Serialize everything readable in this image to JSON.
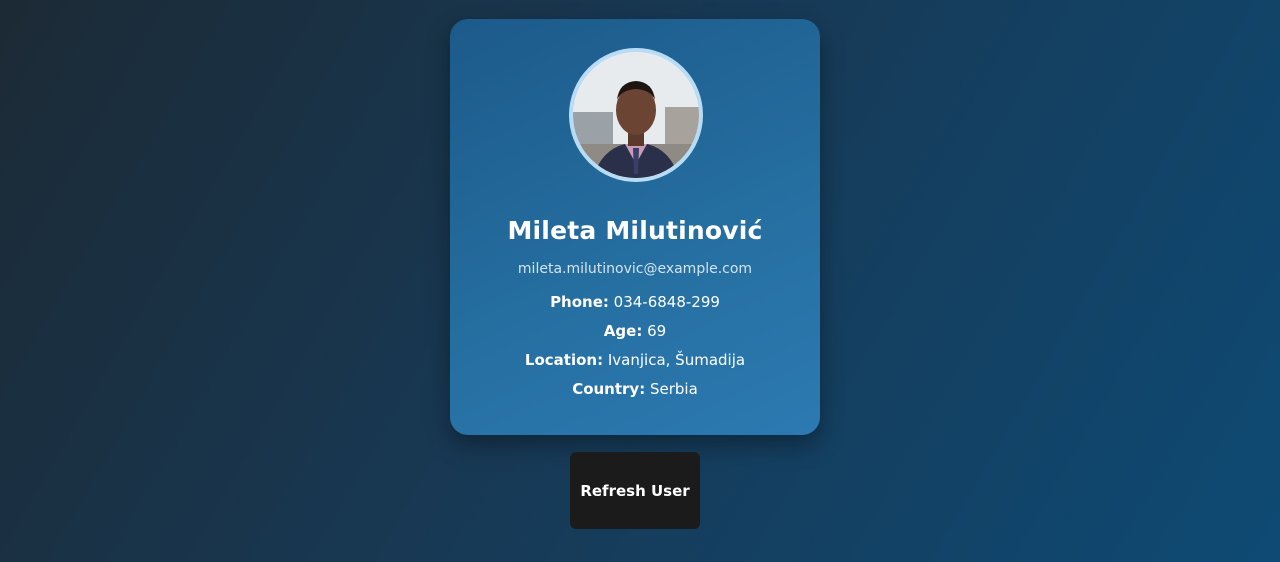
{
  "user": {
    "name": "Mileta Milutinović",
    "email": "mileta.milutinovic@example.com",
    "phone_label": "Phone:",
    "phone": "034-6848-299",
    "age_label": "Age:",
    "age": "69",
    "location_label": "Location:",
    "location": "Ivanjica, Šumadija",
    "country_label": "Country:",
    "country": "Serbia"
  },
  "actions": {
    "refresh_label": "Refresh User"
  }
}
